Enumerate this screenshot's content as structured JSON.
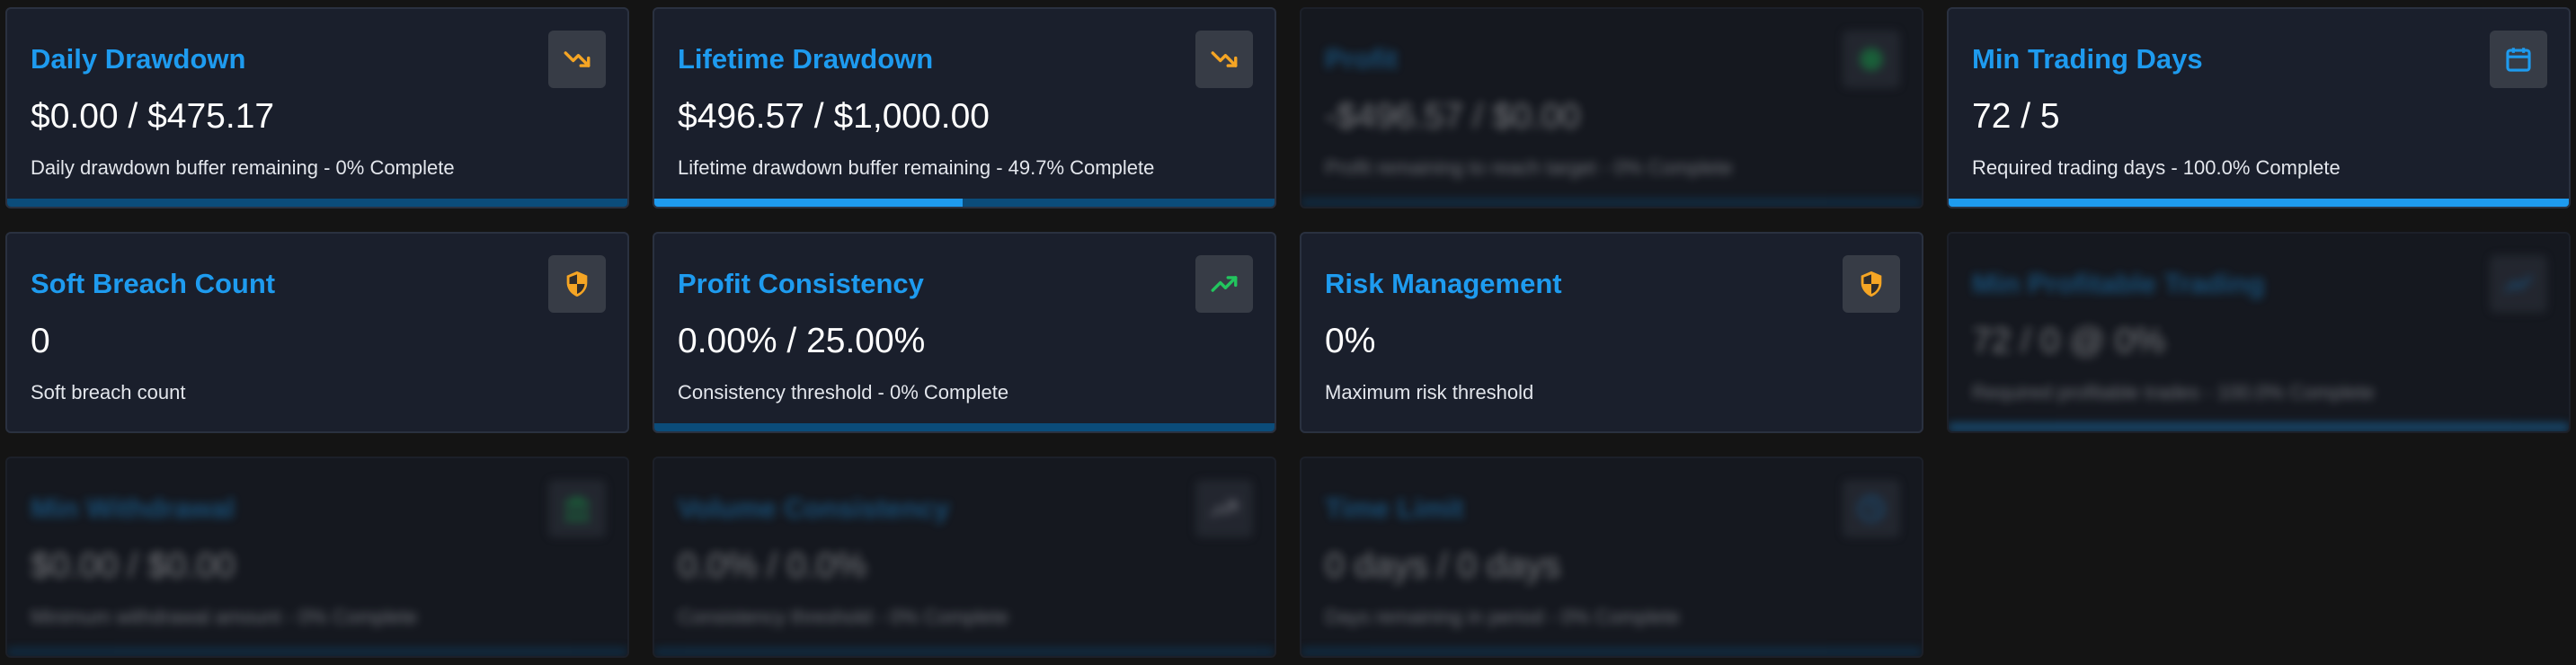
{
  "cards": [
    {
      "title": "Daily Drawdown",
      "value": "$0.00 / $475.17",
      "description": "Daily drawdown buffer remaining - 0% Complete",
      "icon": "trending-down-icon",
      "progress_pct": 0
    },
    {
      "title": "Lifetime Drawdown",
      "value": "$496.57 / $1,000.00",
      "description": "Lifetime drawdown buffer remaining - 49.7% Complete",
      "icon": "trending-down-icon",
      "progress_pct": 49.7
    },
    {
      "title": "Profit",
      "value": "-$496.57 / $0.00",
      "description": "Profit remaining to reach target - 0% Complete",
      "icon": "status-dot-icon",
      "progress_pct": 0
    },
    {
      "title": "Min Trading Days",
      "value": "72 / 5",
      "description": "Required trading days - 100.0% Complete",
      "icon": "calendar-icon",
      "progress_pct": 100
    },
    {
      "title": "Soft Breach Count",
      "value": "0",
      "description": "Soft breach count",
      "icon": "shield-icon"
    },
    {
      "title": "Profit Consistency",
      "value": "0.00% / 25.00%",
      "description": "Consistency threshold - 0% Complete",
      "icon": "trending-up-icon",
      "progress_pct": 0
    },
    {
      "title": "Risk Management",
      "value": "0%",
      "description": "Maximum risk threshold",
      "icon": "shield-icon"
    },
    {
      "title": "Min Profitable Trading",
      "value": "72 / 0 @ 0%",
      "description": "Required profitable trades - 100.0% Complete",
      "icon": "trending-up-icon",
      "progress_pct": 100
    },
    {
      "title": "Min Withdrawal",
      "value": "$0.00 / $0.00",
      "description": "Minimum withdrawal amount - 0% Complete",
      "icon": "bank-icon",
      "progress_pct": 0
    },
    {
      "title": "Volume Consistency",
      "value": "0.0% / 0.0%",
      "description": "Consistency threshold - 0% Complete",
      "icon": "trending-up-icon",
      "progress_pct": 0
    },
    {
      "title": "Time Limit",
      "value": "0 days / 0 days",
      "description": "Days remaining in period - 0% Complete",
      "icon": "clock-icon",
      "progress_pct": 0
    }
  ],
  "colors": {
    "accent": "#1e9bef",
    "track": "#0b4c7a",
    "warning": "#f5a524",
    "success": "#22c55e",
    "background": "#141414",
    "card": "#1a1f2c"
  }
}
